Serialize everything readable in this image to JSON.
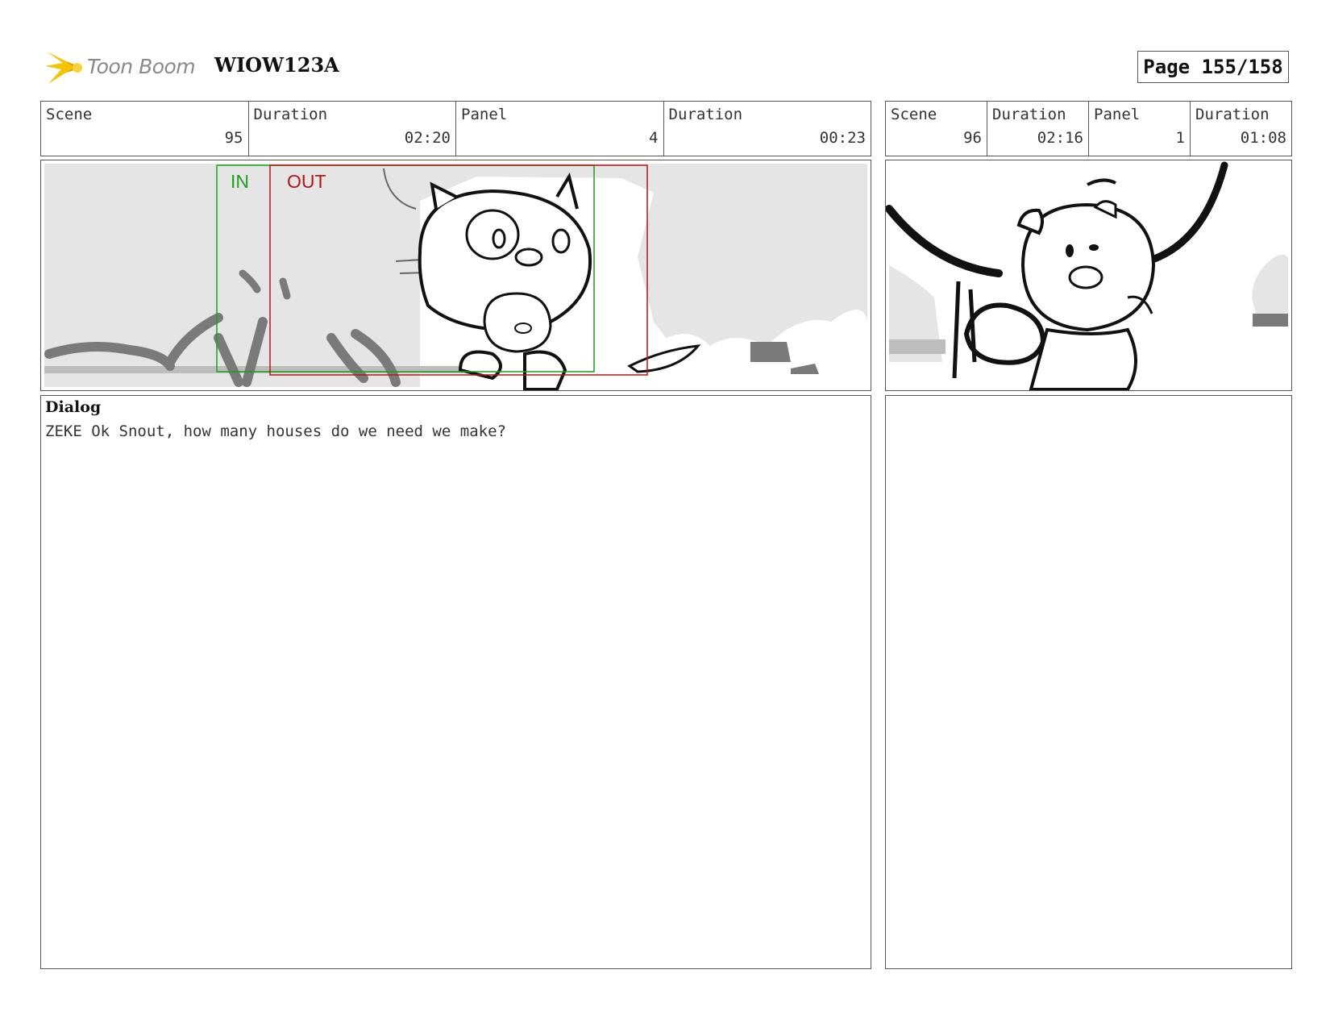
{
  "header": {
    "logo_text": "Toon Boom",
    "doc_title": "WIOW123A",
    "page": "Page 155/158"
  },
  "left_info": {
    "scene_label": "Scene",
    "scene_value": "95",
    "duration_label": "Duration",
    "duration_value": "02:20",
    "panel_label": "Panel",
    "panel_value": "4",
    "panel_duration_label": "Duration",
    "panel_duration_value": "00:23"
  },
  "right_info": {
    "scene_label": "Scene",
    "scene_value": "96",
    "duration_label": "Duration",
    "duration_value": "02:16",
    "panel_label": "Panel",
    "panel_value": "1",
    "panel_duration_label": "Duration",
    "panel_duration_value": "01:08"
  },
  "left_panel": {
    "in_label": "IN",
    "out_label": "OUT"
  },
  "dialog": {
    "label": "Dialog",
    "text": "ZEKE Ok Snout, how many houses do we need we make?"
  },
  "colors": {
    "in_frame": "#1aa11a",
    "out_frame": "#b81616",
    "logo_accent": "#f5c400"
  }
}
